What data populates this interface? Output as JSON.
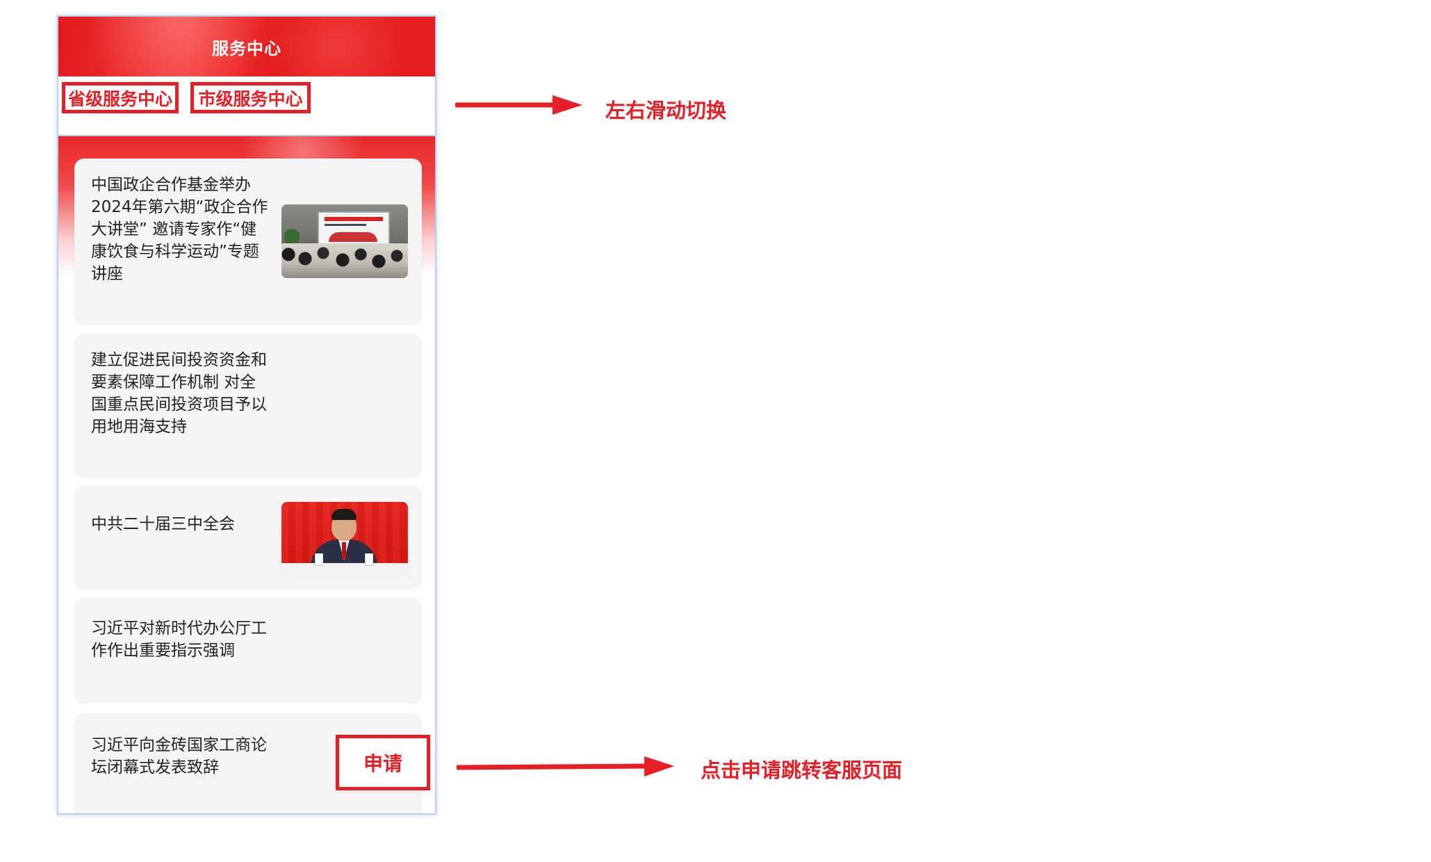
{
  "header": {
    "title": "服务中心"
  },
  "tabs": [
    {
      "label": "省级服务中心"
    },
    {
      "label": "市级服务中心"
    }
  ],
  "articles": [
    {
      "title": "中国政企合作基金举办2024年第六期“政企合作大讲堂” 邀请专家作“健康饮食与科学运动”专题讲座",
      "has_image": true
    },
    {
      "title": "建立促进民间投资资金和要素保障工作机制 对全国重点民间投资项目予以用地用海支持",
      "has_image": false
    },
    {
      "title": "中共二十届三中全会",
      "has_image": true
    },
    {
      "title": "习近平对新时代办公厅工作作出重要指示强调",
      "has_image": false
    },
    {
      "title": "习近平向金砖国家工商论坛闭幕式发表致辞",
      "has_image": false
    }
  ],
  "apply_button": {
    "label": "申请"
  },
  "annotations": {
    "swipe_note": "左右滑动切换",
    "apply_note": "点击申请跳转客服页面"
  },
  "colors": {
    "brand_red": "#e61e25",
    "header_red": "#e1191c",
    "card_bg": "#f4f4f4",
    "frame_border": "#b7cff5"
  }
}
